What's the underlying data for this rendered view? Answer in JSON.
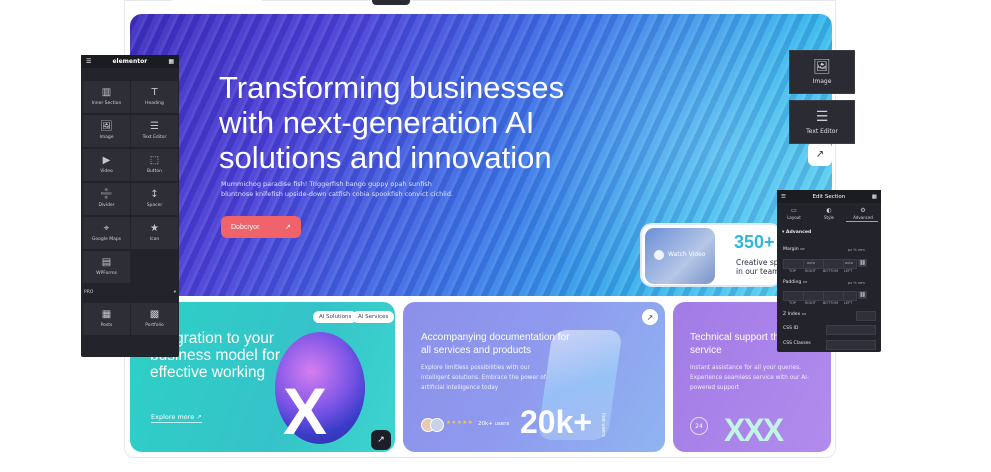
{
  "hero": {
    "title": "Transforming businesses with next-generation AI solutions and innovation",
    "description": "Mummichog paradise fish! Triggerfish bango guppy opah sunfish bluntnose knifefish upside-down catfish cobia spookfish convict cichlid.",
    "cta_label": "Dobcryor",
    "cta_icon": "arrow-up-right-icon",
    "video_label": "Watch Video",
    "stat_number": "350+",
    "stat_label": "Creative sp in our team",
    "accent_color": "#f0636a"
  },
  "cards": {
    "card1": {
      "title": "integration to your business model for effective working",
      "chip1": "AI Solutions",
      "chip2": "AI Services",
      "link": "Explore more",
      "big_letter": "X"
    },
    "card2": {
      "title": "Accompanying documentation for all services and products",
      "description": "Explore limitless possibilities with our intelligent solutions. Embrace the power of artificial intelligence today",
      "stars": "★★★★★",
      "users": "20k+ users",
      "big_number": "20k+",
      "vertical_text": "live users"
    },
    "card3": {
      "title": "Technical support the entire service",
      "description": "Instant assistance for all your queries. Experience seamless service with our AI-powered support",
      "badge": "24",
      "big_letters": "XXX"
    }
  },
  "elementor_panel": {
    "brand": "elementor",
    "widgets": [
      {
        "label": "Inner Section",
        "icon": "columns-icon"
      },
      {
        "label": "Heading",
        "icon": "heading-icon"
      },
      {
        "label": "Image",
        "icon": "image-icon"
      },
      {
        "label": "Text Editor",
        "icon": "text-editor-icon"
      },
      {
        "label": "Video",
        "icon": "video-icon"
      },
      {
        "label": "Button",
        "icon": "button-icon"
      },
      {
        "label": "Divider",
        "icon": "divider-icon"
      },
      {
        "label": "Spacer",
        "icon": "spacer-icon"
      },
      {
        "label": "Google Maps",
        "icon": "map-icon"
      },
      {
        "label": "Icon",
        "icon": "star-icon"
      },
      {
        "label": "WPForms",
        "icon": "form-icon"
      }
    ],
    "pro_label": "PRO",
    "pro_widgets": [
      {
        "label": "Posts",
        "icon": "posts-icon"
      },
      {
        "label": "Portfolio",
        "icon": "portfolio-icon"
      }
    ]
  },
  "floating_widgets": {
    "image_label": "Image",
    "text_editor_label": "Text Editor"
  },
  "edit_section": {
    "title": "Edit Section",
    "tabs": [
      "Layout",
      "Style",
      "Advanced"
    ],
    "section": "Advanced",
    "margin_label": "Margin",
    "padding_label": "Padding",
    "units": "px  %  rem",
    "auto": "auto",
    "sides": [
      "TOP",
      "RIGHT",
      "BOTTOM",
      "LEFT"
    ],
    "z_index_label": "Z Index",
    "css_id_label": "CSS ID",
    "css_classes_label": "CSS Classes"
  }
}
